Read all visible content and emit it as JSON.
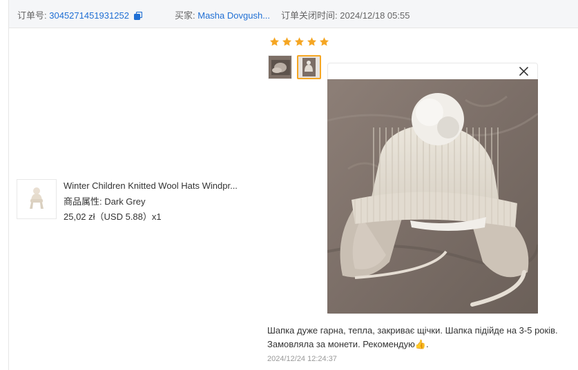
{
  "order": {
    "number_label": "订单号:",
    "number": "3045271451931252",
    "buyer_label": "买家:",
    "buyer": "Masha Dovgush...",
    "close_label": "订单关闭时间:",
    "close_time": "2024/12/18 05:55"
  },
  "product": {
    "name": "Winter Children Knitted Wool Hats Windpr...",
    "attr_label": "商品属性:",
    "attr_value": "Dark Grey",
    "price": "25,02 zł（USD  5.88）x1"
  },
  "review": {
    "rating": 5,
    "text_line1": "Шапка дуже гарна, тепла, закриває щічки. Шапка підійде на 3-5 років.",
    "text_line2": "Замовляла за монети. Рекомендую👍.",
    "date": "2024/12/24 12:24:37"
  },
  "colors": {
    "link": "#1f6fd4",
    "star": "#f5a623",
    "selected_border": "#f5a623"
  },
  "icons": [
    "copy-icon",
    "star-icon",
    "close-icon"
  ]
}
